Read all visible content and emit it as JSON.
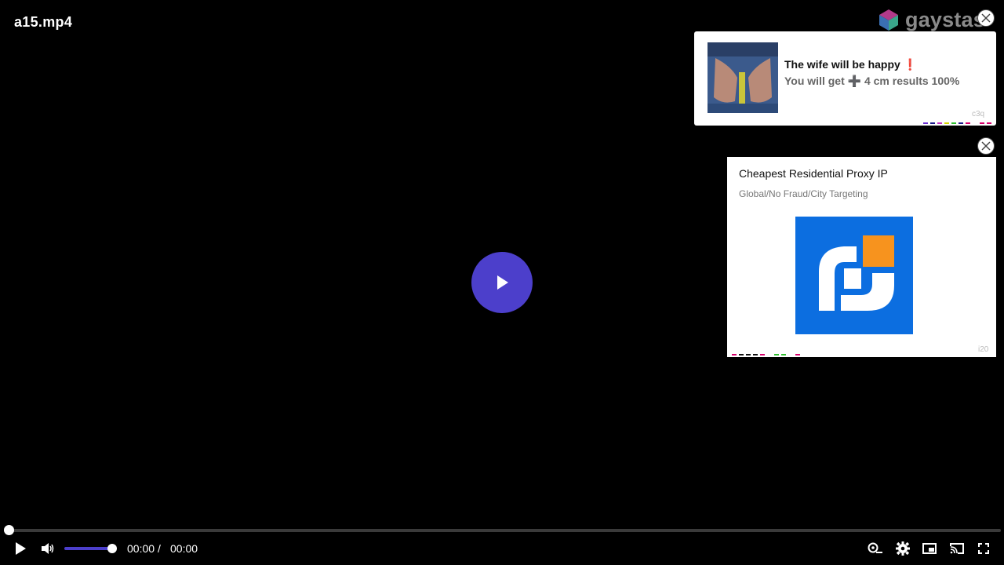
{
  "video": {
    "title": "a15.mp4"
  },
  "brand": {
    "text": "gaystas"
  },
  "ad1": {
    "title": "The wife will be happy",
    "title_emoji": "❗",
    "subtitle": "You will get ➕ 4 cm results 100%",
    "tag": "c3q",
    "dash_colors": [
      "#6b2fd1",
      "#1a1a8a",
      "#c22fc2",
      "#d6d600",
      "#2fbf2f",
      "#1a1a8a",
      "#d6006b",
      "#ffffff",
      "#d6006b",
      "#d6006b"
    ]
  },
  "ad2": {
    "title": "Cheapest Residential Proxy IP",
    "subtitle": "Global/No Fraud/City Targeting",
    "tag": "i20",
    "logo_colors": {
      "background": "#0c6ee0",
      "accent": "#f7931e",
      "mark": "#ffffff"
    },
    "dash_colors": [
      "#d6006b",
      "#111111",
      "#111111",
      "#111111",
      "#d6006b",
      "#ffffff",
      "#2fbf2f",
      "#2fbf2f",
      "#ffffff",
      "#d6006b"
    ]
  },
  "controls": {
    "current_time": "00:00",
    "separator": "/",
    "duration": "00:00",
    "progress": 0,
    "volume": 1.0,
    "accent_color": "#4c3fcb"
  },
  "icons": {
    "play": "play-icon",
    "volume": "volume-icon",
    "quality": "quality-icon",
    "settings": "gear-icon",
    "pip": "picture-in-picture-icon",
    "cast": "cast-icon",
    "fullscreen": "fullscreen-icon",
    "close": "close-icon"
  }
}
